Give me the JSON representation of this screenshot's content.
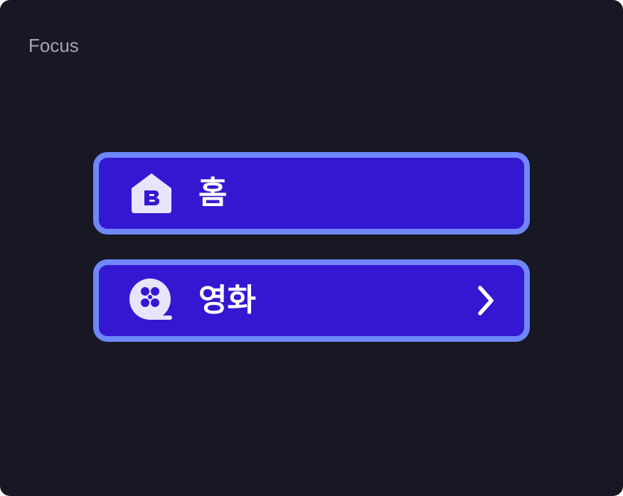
{
  "panel": {
    "label": "Focus"
  },
  "menu": {
    "items": [
      {
        "label": "홈",
        "icon": "home-icon",
        "has_submenu": false
      },
      {
        "label": "영화",
        "icon": "film-reel-icon",
        "has_submenu": true,
        "submenu_icon": "chevron-right-icon"
      }
    ]
  },
  "colors": {
    "background": "#181824",
    "item_fill": "#3418d1",
    "focus_border": "#6f87fa",
    "icon_fill": "#e8e4fb",
    "label_text": "#ffffff",
    "caption_text": "#a5a6b3"
  }
}
